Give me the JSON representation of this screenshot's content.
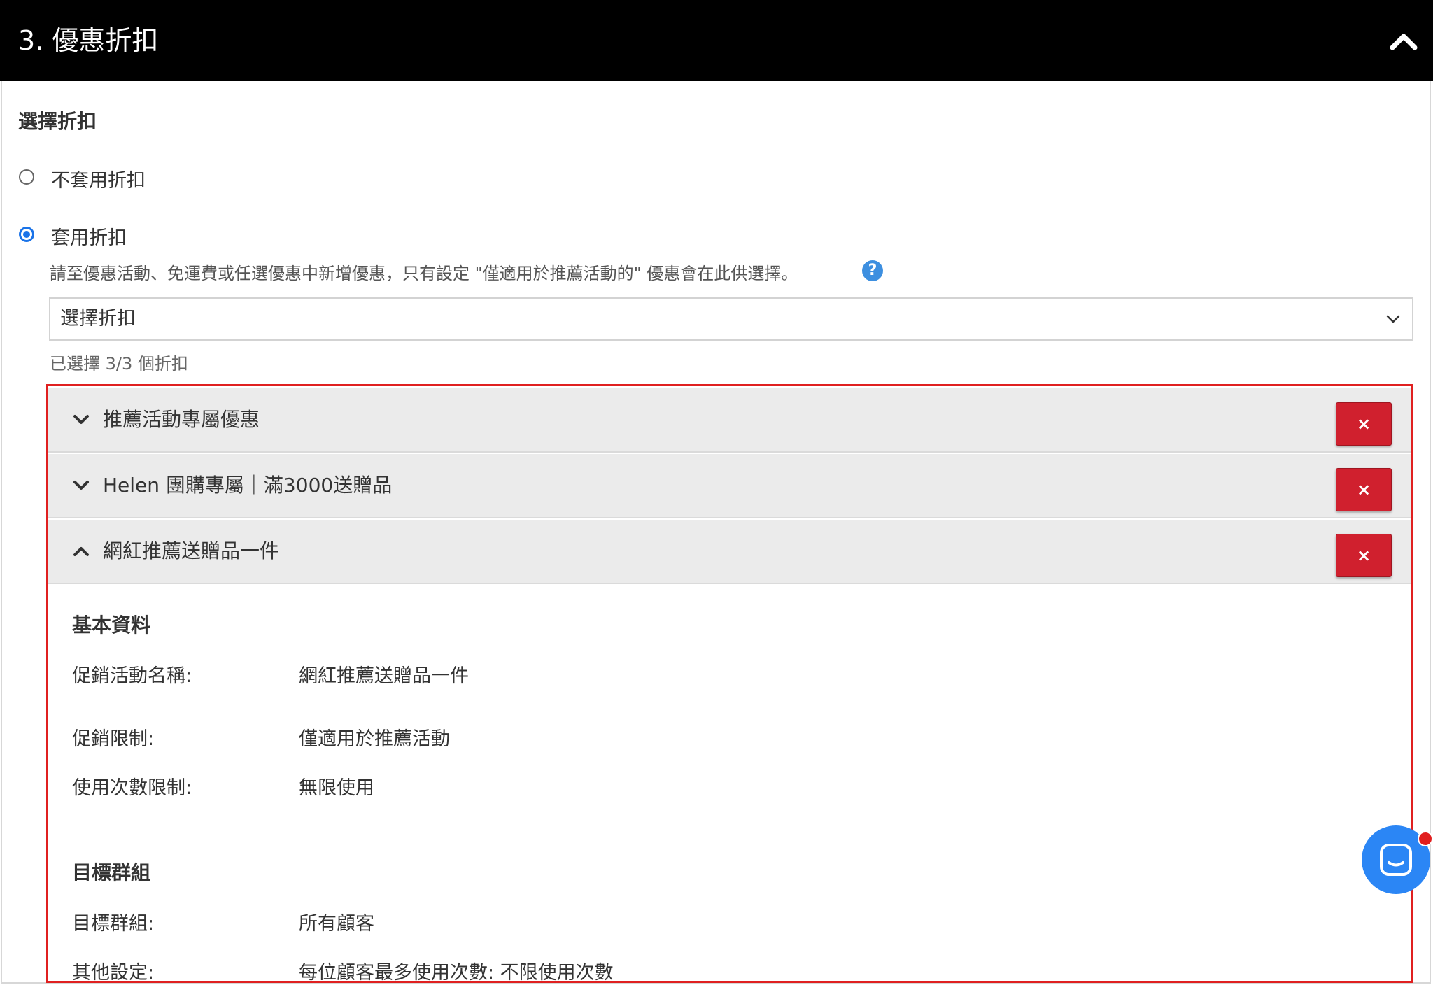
{
  "header": {
    "title": "3. 優惠折扣",
    "collapse_icon": "chevron-up-icon"
  },
  "section": {
    "title": "選擇折扣",
    "options": [
      {
        "label": "不套用折扣",
        "selected": false
      },
      {
        "label": "套用折扣",
        "selected": true
      }
    ],
    "hint": "請至優惠活動、免運費或任選優惠中新增優惠，只有設定 \"僅適用於推薦活動的\" 優惠會在此供選擇。",
    "help_icon": "?",
    "select": {
      "placeholder": "選擇折扣"
    },
    "selected_count": "已選擇 3/3 個折扣"
  },
  "discounts": [
    {
      "title": "推薦活動專屬優惠",
      "expanded": false,
      "remove_label": "×"
    },
    {
      "title": "Helen 團購專屬｜滿3000送贈品",
      "expanded": false,
      "remove_label": "×"
    },
    {
      "title": "網紅推薦送贈品一件",
      "expanded": true,
      "remove_label": "×"
    }
  ],
  "details": {
    "basic": {
      "heading": "基本資料",
      "rows": [
        {
          "label": "促銷活動名稱:",
          "value": "網紅推薦送贈品一件"
        },
        {
          "label": "促銷限制:",
          "value": "僅適用於推薦活動"
        },
        {
          "label": "使用次數限制:",
          "value": "無限使用"
        }
      ]
    },
    "target": {
      "heading": "目標群組",
      "rows": [
        {
          "label": "目標群組:",
          "value": "所有顧客"
        },
        {
          "label": "其他設定:",
          "value": "每位顧客最多使用次數: 不限使用次數"
        }
      ]
    }
  },
  "chat": {
    "icon": "chat-icon",
    "has_notification": true
  },
  "colors": {
    "header_bg": "#000000",
    "accent": "#1a73e8",
    "delete": "#d0202e",
    "highlight_border": "#e02020",
    "chat": "#2b86f5"
  }
}
